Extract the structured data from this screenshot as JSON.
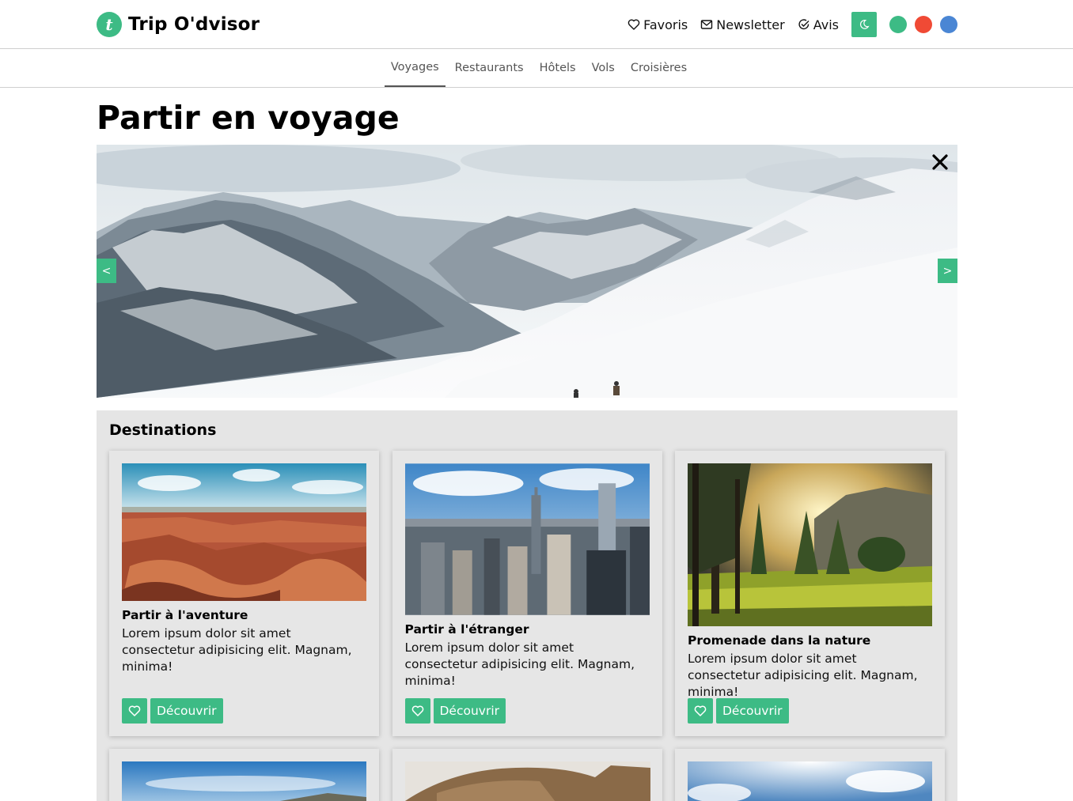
{
  "brand": {
    "logo_letter": "t",
    "name": "Trip O'dvisor",
    "accent": "#3dbb85"
  },
  "top_nav": [
    {
      "label": "Favoris",
      "icon": "heart-icon"
    },
    {
      "label": "Newsletter",
      "icon": "mail-icon"
    },
    {
      "label": "Avis",
      "icon": "check-circle-icon"
    }
  ],
  "theme_toggle": {
    "icon": "moon-icon"
  },
  "color_swatches": [
    "#3dbb85",
    "#f04a35",
    "#4a86d4"
  ],
  "tabs": [
    {
      "label": "Voyages",
      "active": true
    },
    {
      "label": "Restaurants",
      "active": false
    },
    {
      "label": "Hôtels",
      "active": false
    },
    {
      "label": "Vols",
      "active": false
    },
    {
      "label": "Croisières",
      "active": false
    }
  ],
  "page_title": "Partir en voyage",
  "carousel": {
    "prev_label": "<",
    "next_label": ">",
    "close_icon": "close-icon",
    "image": "snowy-mountain-slope-with-hikers"
  },
  "destinations": {
    "title": "Destinations",
    "cards": [
      {
        "title": "Partir à l'aventure",
        "text": "Lorem ipsum dolor sit amet consectetur adipisicing elit. Magnam, minima!",
        "button": "Découvrir",
        "image": "red-rock-canyon"
      },
      {
        "title": "Partir à l'étranger",
        "text": "Lorem ipsum dolor sit amet consectetur adipisicing elit. Magnam, minima!",
        "button": "Découvrir",
        "image": "city-skyline"
      },
      {
        "title": "Promenade dans la nature",
        "text": "Lorem ipsum dolor sit amet consectetur adipisicing elit. Magnam, minima!",
        "button": "Découvrir",
        "image": "forest-meadow-sunset"
      }
    ],
    "more_cards": [
      {
        "image": "blue-sky-hills"
      },
      {
        "image": "desert-rock-dome"
      },
      {
        "image": "sunny-clouds"
      }
    ]
  }
}
